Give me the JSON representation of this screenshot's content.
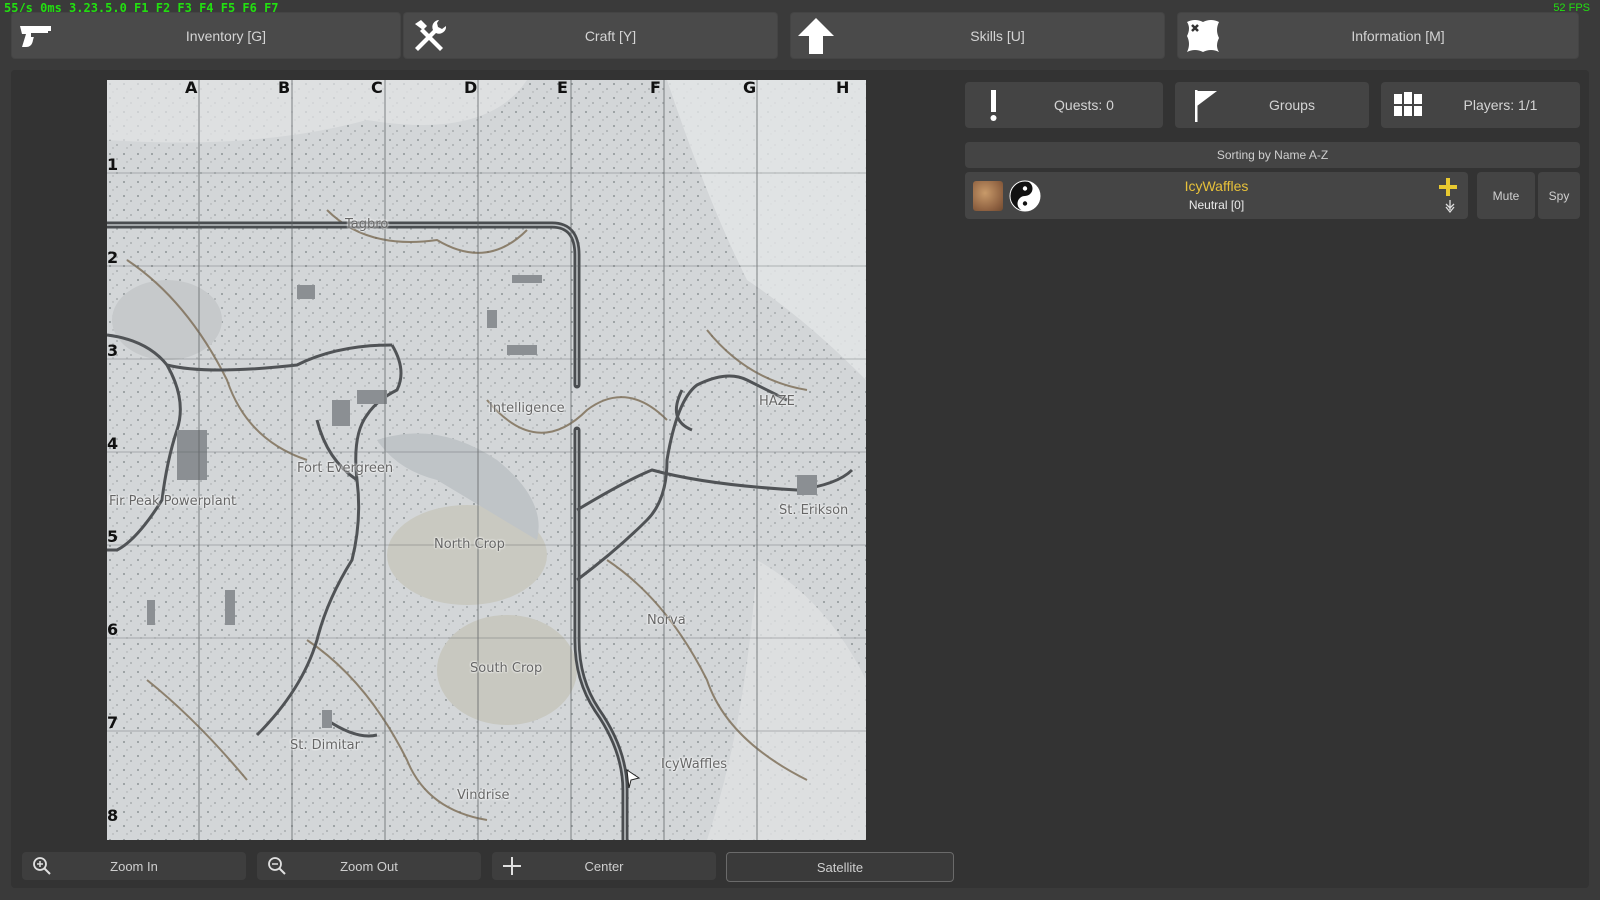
{
  "debug": {
    "text": "55/s 0ms 3.23.5.0 F1 F2 F3 F4 F5 F6 F7",
    "fps": "52 FPS"
  },
  "tabs": [
    {
      "label": "Inventory [G]",
      "icon": "pistol-icon"
    },
    {
      "label": "Craft [Y]",
      "icon": "crossed-tools-icon"
    },
    {
      "label": "Skills [U]",
      "icon": "arrow-up-icon"
    },
    {
      "label": "Information [M]",
      "icon": "map-scroll-icon"
    }
  ],
  "map": {
    "columns": [
      "A",
      "B",
      "C",
      "D",
      "E",
      "F",
      "G",
      "H"
    ],
    "rows": [
      "1",
      "2",
      "3",
      "4",
      "5",
      "6",
      "7",
      "8"
    ],
    "locations": [
      "Tagbro",
      "Intelligence",
      "HAZE",
      "Fort Evergreen",
      "Fir Peak Powerplant",
      "St. Erikson",
      "North Crop",
      "Norva",
      "South Crop",
      "St. Dimitar",
      "IcyWaffles",
      "Vindrise"
    ],
    "buttons": {
      "zoom_in": "Zoom In",
      "zoom_out": "Zoom Out",
      "center": "Center",
      "satellite": "Satellite"
    }
  },
  "sidebar": {
    "quests": "Quests: 0",
    "groups": "Groups",
    "players": "Players: 1/1",
    "sorting": "Sorting by Name A-Z",
    "player": {
      "name": "IcyWaffles",
      "faction": "Neutral [0]",
      "mute": "Mute",
      "spy": "Spy"
    }
  },
  "colors": {
    "background": "#3a3a3a",
    "panel": "#333333",
    "debug_green": "#22e010",
    "player_name": "#e7c13a",
    "plus_yellow": "#e8c930"
  }
}
